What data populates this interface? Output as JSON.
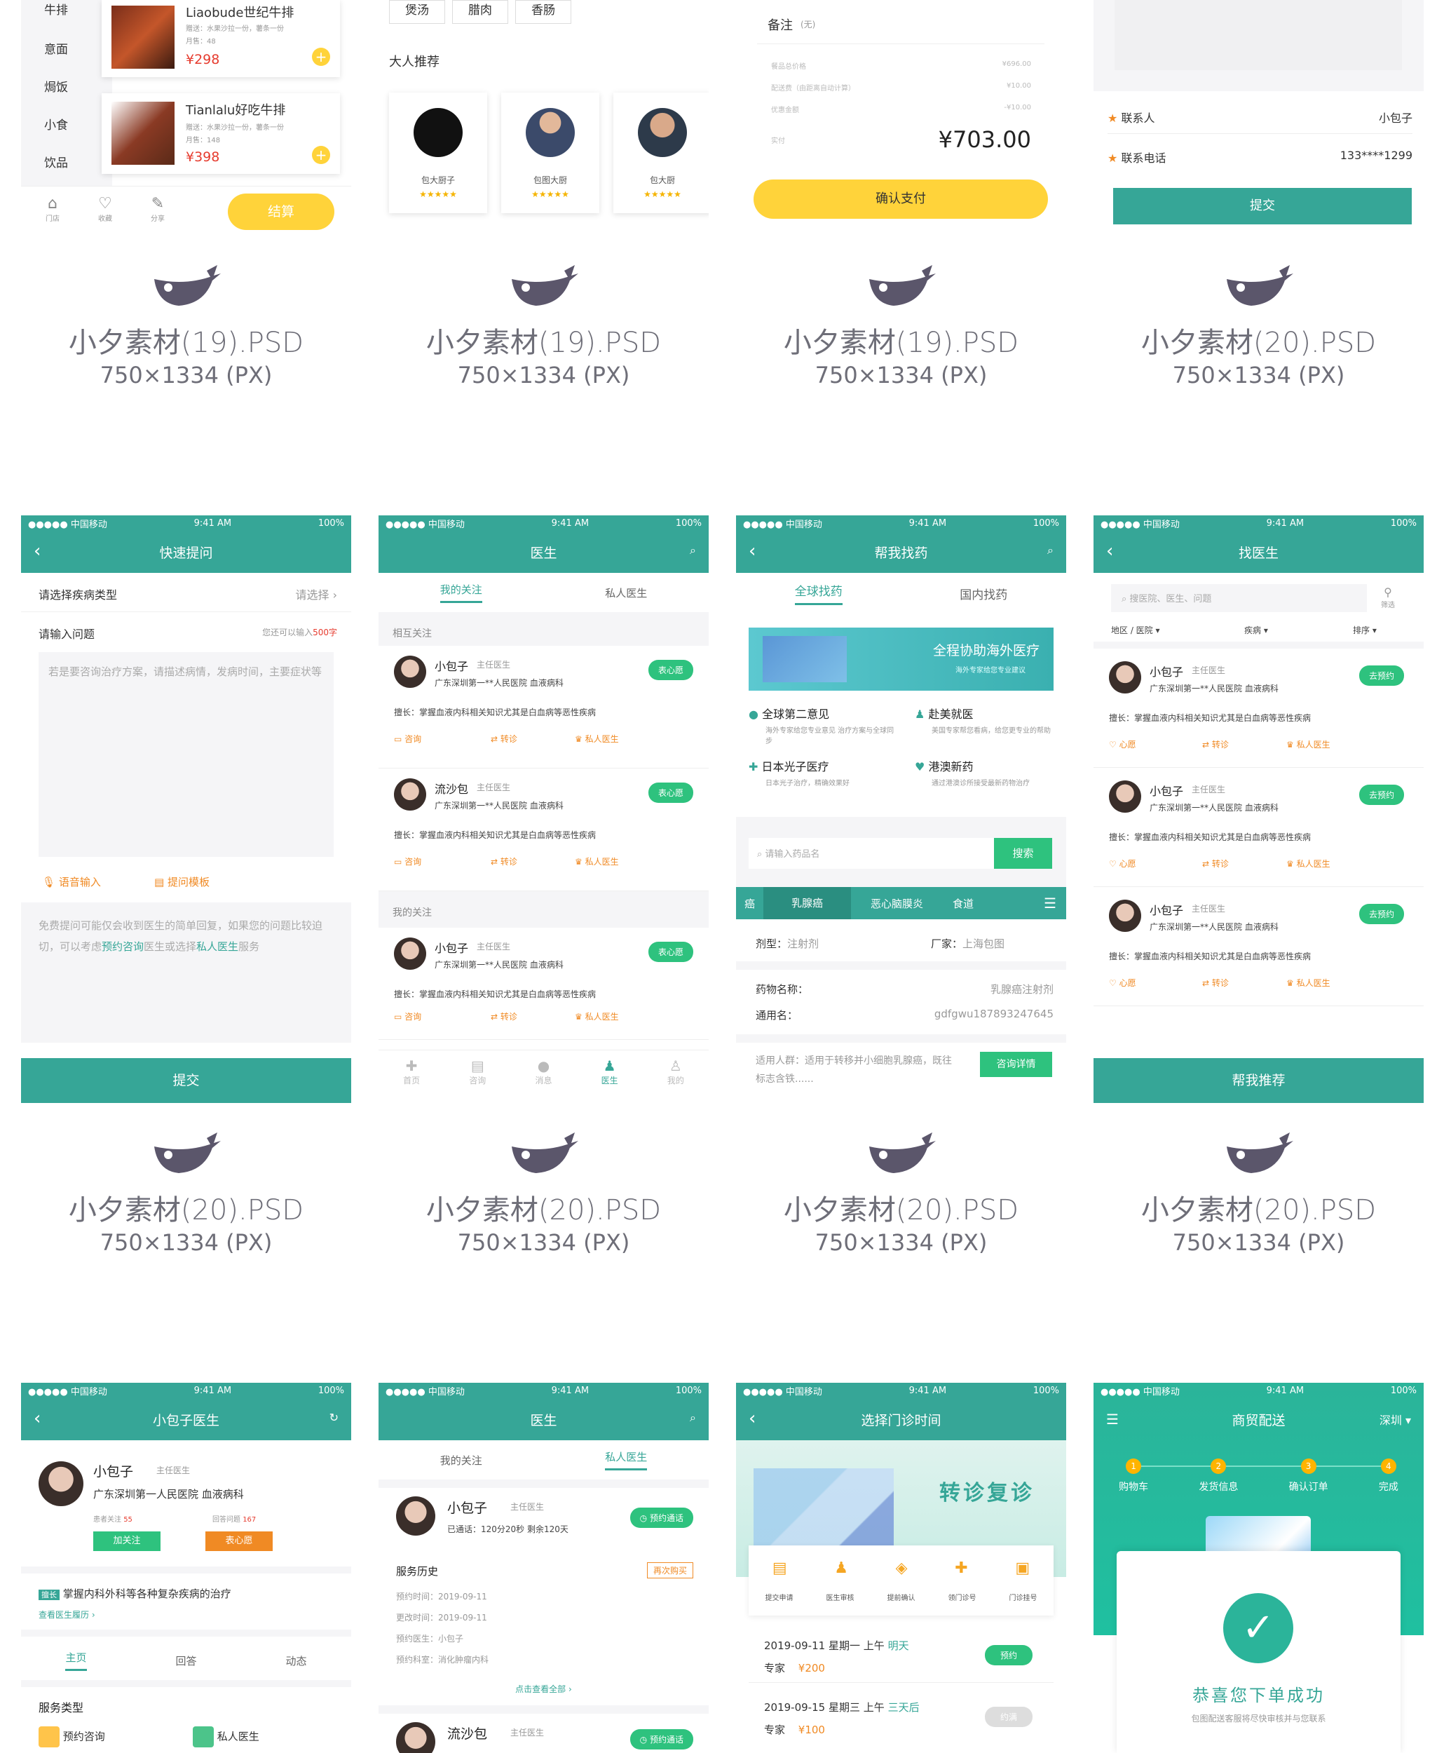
{
  "captions": [
    {
      "name": "小夕素材(19).PSD",
      "size": "750×1334 (PX)"
    },
    {
      "name": "小夕素材(19).PSD",
      "size": "750×1334 (PX)"
    },
    {
      "name": "小夕素材(19).PSD",
      "size": "750×1334 (PX)"
    },
    {
      "name": "小夕素材(20).PSD",
      "size": "750×1334 (PX)"
    },
    {
      "name": "小夕素材(20).PSD",
      "size": "750×1334 (PX)"
    },
    {
      "name": "小夕素材(20).PSD",
      "size": "750×1334 (PX)"
    },
    {
      "name": "小夕素材(20).PSD",
      "size": "750×1334 (PX)"
    },
    {
      "name": "小夕素材(20).PSD",
      "size": "750×1334 (PX)"
    }
  ],
  "colors": {
    "teal": "#36a697",
    "green": "#2ec27e",
    "yellow": "#ffd33a",
    "orange": "#f08a24",
    "logo": "#5b566b"
  },
  "status": {
    "carrier": "●●●●● 中国移动",
    "time": "9:41 AM",
    "battery": "100%"
  },
  "s1": {
    "categories": [
      "牛排",
      "意面",
      "焗饭",
      "小食",
      "饮品"
    ],
    "items": [
      {
        "name": "Liaobude世纪牛排",
        "desc": "赠送：水果沙拉一份，薯条一份",
        "sales": "月售：48",
        "price": "¥298"
      },
      {
        "name": "Tianlalu好吃牛排",
        "desc": "赠送：水果沙拉一份，薯条一份",
        "sales": "月售：148",
        "price": "¥398"
      }
    ],
    "bottom": {
      "store": "门店",
      "fav": "收藏",
      "share": "分享",
      "checkout": "结算"
    }
  },
  "s2": {
    "tags": [
      "煲汤",
      "腊肉",
      "香肠"
    ],
    "section": "大人推荐",
    "chefs": [
      {
        "name": "包大厨子",
        "stars": "★★★★★"
      },
      {
        "name": "包图大厨",
        "stars": "★★★★★"
      },
      {
        "name": "包大厨",
        "stars": "★★★★★"
      }
    ]
  },
  "s3": {
    "remark_label": "备注",
    "remark_value": "(无)",
    "lines": [
      {
        "k": "餐品总价格",
        "v": "¥696.00"
      },
      {
        "k": "配送费（由距离自动计算）",
        "v": "¥10.00"
      },
      {
        "k": "优惠金额",
        "v": "-¥10.00"
      }
    ],
    "paid_label": "实付",
    "paid_value": "¥703.00",
    "confirm": "确认支付"
  },
  "s4": {
    "contact_label": "联系人",
    "contact_value": "小包子",
    "phone_label": "联系电话",
    "phone_value": "133****1299",
    "submit": "提交"
  },
  "s5": {
    "title": "快速提问",
    "type_label": "请选择疾病类型",
    "type_value": "请选择",
    "input_label": "请输入问题",
    "input_hint": "您还可以输入",
    "input_count": "500字",
    "placeholder": "若是要咨询治疗方案，请描述病情，发病时间，主要症状等",
    "voice": "语音输入",
    "template": "提问模板",
    "notice_a": "免费提问可能仅会收到医生的简单回复，如果您的问题比较迫切，可以考虑",
    "notice_link1": "预约咨询",
    "notice_b": "医生或选择",
    "notice_link2": "私人医生",
    "notice_c": "服务",
    "submit": "提交"
  },
  "s6": {
    "title": "医生",
    "tab1": "我的关注",
    "tab2": "私人医生",
    "sec1": "相互关注",
    "sec2": "我的关注",
    "docs": [
      {
        "name": "小包子",
        "title": "主任医生",
        "hosp": "广东深圳第一**人民医院  血液病科",
        "skill": "擅长：掌握血液内科相关知识尤其是白血病等恶性疾病",
        "btn": "表心愿"
      },
      {
        "name": "流沙包",
        "title": "主任医生",
        "hosp": "广东深圳第一**人民医院  血液病科",
        "skill": "擅长：掌握血液内科相关知识尤其是白血病等恶性疾病",
        "btn": "表心愿"
      },
      {
        "name": "小包子",
        "title": "主任医生",
        "hosp": "广东深圳第一**人民医院  血液病科",
        "skill": "擅长：掌握血液内科相关知识尤其是白血病等恶性疾病",
        "btn": "表心愿"
      }
    ],
    "actions": [
      "咨询",
      "转诊",
      "私人医生"
    ],
    "tabs": [
      "首页",
      "咨询",
      "消息",
      "医生",
      "我的"
    ]
  },
  "s7": {
    "title": "帮我找药",
    "tab1": "全球找药",
    "tab2": "国内找药",
    "banner_title": "全程协助海外医疗",
    "banner_sub": "海外专家给您专业建议",
    "services": [
      {
        "t": "全球第二意见",
        "d": "海外专家给您专业意见 治疗方案与全球同步"
      },
      {
        "t": "赴美就医",
        "d": "美国专家帮您看病，给您更专业的帮助"
      },
      {
        "t": "日本光子医疗",
        "d": "日本光子治疗，精确效果好"
      },
      {
        "t": "港澳新药",
        "d": "通过港澳诊所接受最新药物治疗"
      }
    ],
    "search_ph": "请输入药品名",
    "search_btn": "搜索",
    "cats": [
      "癌",
      "乳腺癌",
      "恶心脑膜炎",
      "食道"
    ],
    "type_label": "剂型：",
    "type_value": "注射剂",
    "maker_label": "厂家：",
    "maker_value": "上海包图",
    "drug_label": "药物名称：",
    "drug_value": "乳腺癌注射剂",
    "generic_label": "通用名：",
    "generic_value": "gdfgwu187893247645",
    "people_label": "适用人群：",
    "people_value": "适用于转移并小细胞乳腺癌，既往标志含铁......",
    "detail_btn": "咨询详情"
  },
  "s8": {
    "title": "找医生",
    "search_ph": "搜医院、医生、问题",
    "filter": "筛选",
    "filters": [
      "地区 / 医院",
      "疾病",
      "排序"
    ],
    "docs": [
      {
        "name": "小包子",
        "title": "主任医生",
        "hosp": "广东深圳第一**人民医院  血液病科",
        "skill": "擅长：掌握血液内科相关知识尤其是白血病等恶性疾病",
        "btn": "去预约"
      },
      {
        "name": "小包子",
        "title": "主任医生",
        "hosp": "广东深圳第一**人民医院  血液病科",
        "skill": "擅长：掌握血液内科相关知识尤其是白血病等恶性疾病",
        "btn": "去预约"
      },
      {
        "name": "小包子",
        "title": "主任医生",
        "hosp": "广东深圳第一**人民医院  血液病科",
        "skill": "擅长：掌握血液内科相关知识尤其是白血病等恶性疾病",
        "btn": "去预约"
      }
    ],
    "actions": [
      "心愿",
      "转诊",
      "私人医生"
    ],
    "recommend": "帮我推荐"
  },
  "s9": {
    "title": "小包子医生",
    "name": "小包子",
    "doc_title": "主任医生",
    "hosp": "广东深圳第一人民医院  血液病科",
    "fans_label": "患者关注",
    "fans": "55",
    "answers_label": "回答问题",
    "answers": "167",
    "follow": "加关注",
    "wish": "表心愿",
    "skill_tag": "擅长",
    "skill": "掌握内科外科等各种复杂疾病的治疗",
    "more": "查看医生履历",
    "tabs": [
      "主页",
      "回答",
      "动态"
    ],
    "svc_title": "服务类型",
    "svc": [
      "预约咨询",
      "私人医生"
    ]
  },
  "s10": {
    "title": "医生",
    "tab1": "我的关注",
    "tab2": "私人医生",
    "name": "小包子",
    "doc_title": "主任医生",
    "call": "已通话：120分20秒  剩余120天",
    "call_btn": "预约通话",
    "history": "服务历史",
    "rebuy": "再次购买",
    "records": [
      {
        "k": "预约时间：",
        "v": "2019-09-11"
      },
      {
        "k": "更改时间：",
        "v": "2019-09-11"
      },
      {
        "k": "预约医生：",
        "v": "小包子"
      },
      {
        "k": "预约科室：",
        "v": "消化肿瘤内科"
      }
    ],
    "view_all": "点击查看全部",
    "name2": "流沙包",
    "doc_title2": "主任医生",
    "call_btn2": "预约通话"
  },
  "s11": {
    "title": "选择门诊时间",
    "hero": "转诊复诊",
    "steps": [
      "提交申请",
      "医生审核",
      "提前确认",
      "领门诊号",
      "门诊挂号"
    ],
    "slots": [
      {
        "date": "2019-09-11",
        "week": "星期一",
        "ampm": "上午",
        "rel": "明天",
        "kind": "专家",
        "price": "¥200",
        "btn": "预约"
      },
      {
        "date": "2019-09-15",
        "week": "星期三",
        "ampm": "上午",
        "rel": "三天后",
        "kind": "专家",
        "price": "¥100",
        "btn": "约满"
      }
    ]
  },
  "s12": {
    "title": "商贸配送",
    "city": "深圳",
    "steps": [
      {
        "n": "1",
        "t": "购物车"
      },
      {
        "n": "2",
        "t": "发货信息"
      },
      {
        "n": "3",
        "t": "确认订单"
      },
      {
        "n": "4",
        "t": "完成"
      }
    ],
    "success": "恭喜您下单成功",
    "success_sub": "包图配送客服将尽快审核并与您联系"
  }
}
